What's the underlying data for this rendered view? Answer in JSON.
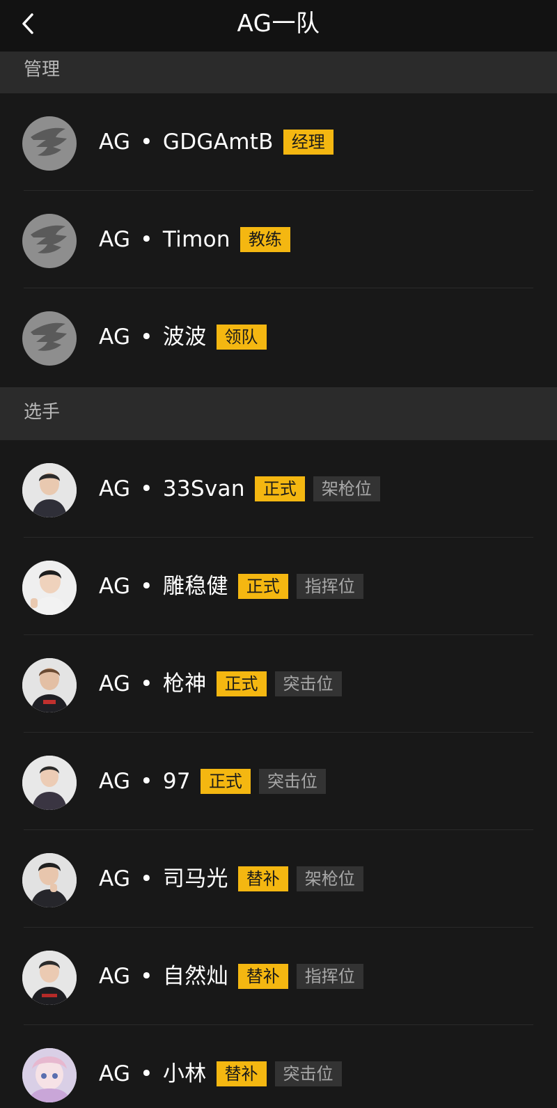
{
  "header": {
    "title": "AG一队",
    "back_icon": "chevron-left-icon"
  },
  "sections": [
    {
      "title": "管理",
      "members": [
        {
          "team": "AG",
          "separator": "•",
          "name": "GDGAmtB",
          "role": "经理",
          "avatar": "team-logo"
        },
        {
          "team": "AG",
          "separator": "•",
          "name": "Timon",
          "role": "教练",
          "avatar": "team-logo"
        },
        {
          "team": "AG",
          "separator": "•",
          "name": "波波",
          "role": "领队",
          "avatar": "team-logo"
        }
      ]
    },
    {
      "title": "选手",
      "members": [
        {
          "team": "AG",
          "separator": "•",
          "name": "33Svan",
          "role": "正式",
          "position": "架枪位",
          "avatar": "player-photo"
        },
        {
          "team": "AG",
          "separator": "•",
          "name": "雕稳健",
          "role": "正式",
          "position": "指挥位",
          "avatar": "player-photo"
        },
        {
          "team": "AG",
          "separator": "•",
          "name": "枪神",
          "role": "正式",
          "position": "突击位",
          "avatar": "player-photo"
        },
        {
          "team": "AG",
          "separator": "•",
          "name": "97",
          "role": "正式",
          "position": "突击位",
          "avatar": "player-photo"
        },
        {
          "team": "AG",
          "separator": "•",
          "name": "司马光",
          "role": "替补",
          "position": "架枪位",
          "avatar": "player-photo"
        },
        {
          "team": "AG",
          "separator": "•",
          "name": "自然灿",
          "role": "替补",
          "position": "指挥位",
          "avatar": "player-photo"
        },
        {
          "team": "AG",
          "separator": "•",
          "name": "小林",
          "role": "替补",
          "position": "突击位",
          "avatar": "player-photo"
        }
      ]
    }
  ],
  "colors": {
    "background": "#181818",
    "section_bg": "#2b2b2b",
    "role_badge": "#f4b711",
    "position_badge": "#333333"
  }
}
